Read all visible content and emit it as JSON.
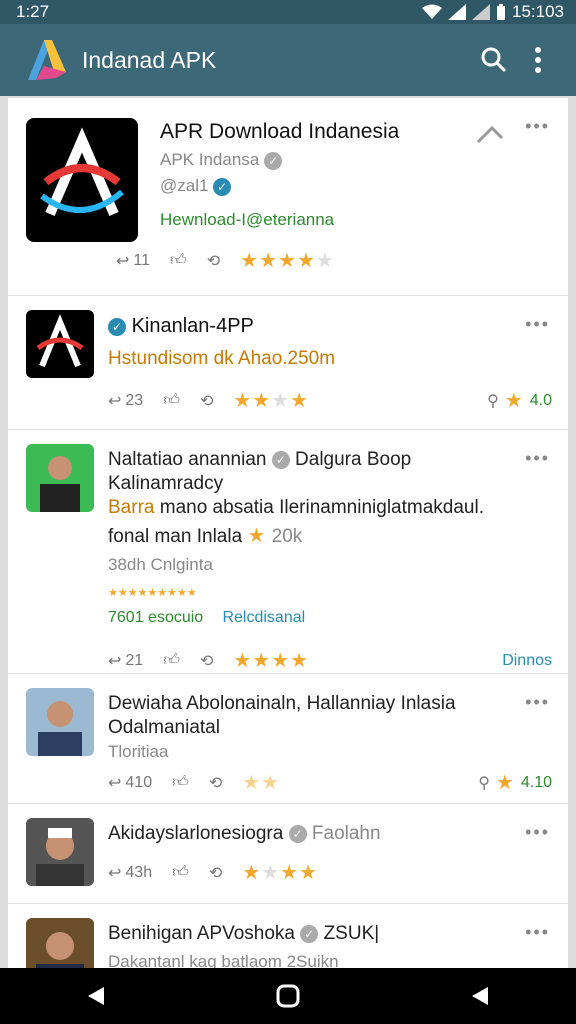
{
  "status": {
    "time_left": "1:27",
    "time_right": "15:103"
  },
  "app_bar": {
    "title": "Indanad APK"
  },
  "posts": [
    {
      "title": "APR Download Indanesia",
      "subtitle": "APK Indansa",
      "handle": "@zal1",
      "link": "Hewnload-I@eterianna",
      "reply_count": "11",
      "rating": 3.5
    },
    {
      "title": "Kinanlan-4PP",
      "highlight": "Hstundisom dk Ahao.250m",
      "reply_count": "23",
      "rating": 2,
      "meta": "4.0"
    },
    {
      "title": "Naltatiao anannian",
      "title_suffix": "Dalgura Boop",
      "line2": "Kalinamradcy",
      "line3_orange": "Barra",
      "line3_rest": "mano absatia Ilerinamniniglatmakdaul.",
      "line4": "fonal man Inlala",
      "line4_rating": "20k",
      "sub": "38dh Cnlginta",
      "mini_count": "7601 esocuio",
      "mini_link": "Relcdisanal",
      "reply_count": "21",
      "rating": 3.5,
      "meta_link": "Dinnos"
    },
    {
      "title": "Dewiaha Abolonainaln, Hallanniay Inlasia",
      "line2": "Odalmaniatal",
      "sub": "Tloritiaa",
      "reply_count": "410",
      "rating": 2,
      "meta": "4.10"
    },
    {
      "title": "Akidayslarlonesiogra",
      "title_suffix": "Faolahn",
      "reply_count": "43h",
      "rating": 2.5
    },
    {
      "title": "Benihigan APVoshoka",
      "title_suffix": "ZSUK|",
      "line2": "Dakantanl kag batlaom 2Suikn"
    }
  ],
  "icons": {
    "search": "search-icon",
    "more": "more-vert-icon",
    "reply": "reply-icon",
    "like": "thumb-up-icon",
    "repost": "repost-icon",
    "back": "back-triangle-icon",
    "home": "home-circle-icon",
    "recent": "recent-triangle-icon"
  },
  "colors": {
    "app_bar": "#3d6878",
    "accent_star": "#f1a82c",
    "green_link": "#2e8b2e",
    "orange_text": "#c77b00"
  }
}
